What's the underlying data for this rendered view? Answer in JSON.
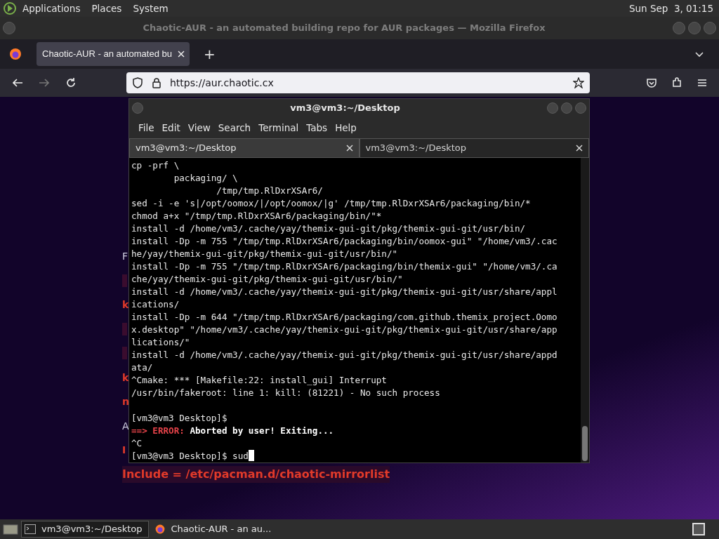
{
  "top_panel": {
    "menus": [
      "Applications",
      "Places",
      "System"
    ],
    "clock": "Sun Sep  3, 01:15"
  },
  "browser": {
    "title": "Chaotic-AUR - an automated building repo for AUR packages — Mozilla Firefox",
    "tabs": [
      {
        "label": "Chaotic-AUR - an automated bu",
        "selected": true
      }
    ],
    "new_tab": "+",
    "url": "https://aur.chaotic.cx",
    "page_fragments": [
      {
        "text": "F",
        "kind": "plain"
      },
      {
        "kind": "mark"
      },
      {
        "text": "k",
        "kind": "red"
      },
      {
        "kind": "mark"
      },
      {
        "kind": "mark"
      },
      {
        "text": "k",
        "kind": "red"
      },
      {
        "text": "n",
        "kind": "red"
      },
      {
        "text": "A",
        "kind": "plain"
      },
      {
        "text": "I",
        "kind": "red"
      }
    ],
    "page_line": "Include = /etc/pacman.d/chaotic-mirrorlist"
  },
  "terminal": {
    "title": "vm3@vm3:~/Desktop",
    "menu": [
      "File",
      "Edit",
      "View",
      "Search",
      "Terminal",
      "Tabs",
      "Help"
    ],
    "tabs": [
      {
        "label": "vm3@vm3:~/Desktop",
        "selected": true
      },
      {
        "label": "vm3@vm3:~/Desktop",
        "selected": false
      }
    ],
    "lines": [
      {
        "kind": "text",
        "text": "cp -prf \\"
      },
      {
        "kind": "text",
        "text": "        packaging/ \\"
      },
      {
        "kind": "text",
        "text": "                /tmp/tmp.RlDxrXSAr6/"
      },
      {
        "kind": "text",
        "text": "sed -i -e 's|/opt/oomox/|/opt/oomox/|g' /tmp/tmp.RlDxrXSAr6/packaging/bin/*"
      },
      {
        "kind": "text",
        "text": "chmod a+x \"/tmp/tmp.RlDxrXSAr6/packaging/bin/\"*"
      },
      {
        "kind": "text",
        "text": "install -d /home/vm3/.cache/yay/themix-gui-git/pkg/themix-gui-git/usr/bin/"
      },
      {
        "kind": "text",
        "text": "install -Dp -m 755 \"/tmp/tmp.RlDxrXSAr6/packaging/bin/oomox-gui\" \"/home/vm3/.cac"
      },
      {
        "kind": "text",
        "text": "he/yay/themix-gui-git/pkg/themix-gui-git/usr/bin/\""
      },
      {
        "kind": "text",
        "text": "install -Dp -m 755 \"/tmp/tmp.RlDxrXSAr6/packaging/bin/themix-gui\" \"/home/vm3/.ca"
      },
      {
        "kind": "text",
        "text": "che/yay/themix-gui-git/pkg/themix-gui-git/usr/bin/\""
      },
      {
        "kind": "text",
        "text": "install -d /home/vm3/.cache/yay/themix-gui-git/pkg/themix-gui-git/usr/share/appl"
      },
      {
        "kind": "text",
        "text": "ications/"
      },
      {
        "kind": "text",
        "text": "install -Dp -m 644 \"/tmp/tmp.RlDxrXSAr6/packaging/com.github.themix_project.Oomo"
      },
      {
        "kind": "text",
        "text": "x.desktop\" \"/home/vm3/.cache/yay/themix-gui-git/pkg/themix-gui-git/usr/share/app"
      },
      {
        "kind": "text",
        "text": "lications/\""
      },
      {
        "kind": "text",
        "text": "install -d /home/vm3/.cache/yay/themix-gui-git/pkg/themix-gui-git/usr/share/appd"
      },
      {
        "kind": "text",
        "text": "ata/"
      },
      {
        "kind": "text",
        "text": "^Cmake: *** [Makefile:22: install_gui] Interrupt"
      },
      {
        "kind": "text",
        "text": "/usr/bin/fakeroot: line 1: kill: (81221) - No such process"
      },
      {
        "kind": "blank"
      },
      {
        "kind": "text",
        "text": "[vm3@vm3 Desktop]$"
      },
      {
        "kind": "error",
        "prefix": "==> ERROR:",
        "text": "Aborted by user! Exiting..."
      },
      {
        "kind": "text",
        "text": "^C"
      },
      {
        "kind": "input",
        "text": "[vm3@vm3 Desktop]$ sud"
      }
    ]
  },
  "taskbar": [
    {
      "label": "vm3@vm3:~/Desktop",
      "kind": "terminal",
      "selected": true
    },
    {
      "label": "Chaotic-AUR - an au...",
      "kind": "firefox",
      "selected": false
    }
  ]
}
